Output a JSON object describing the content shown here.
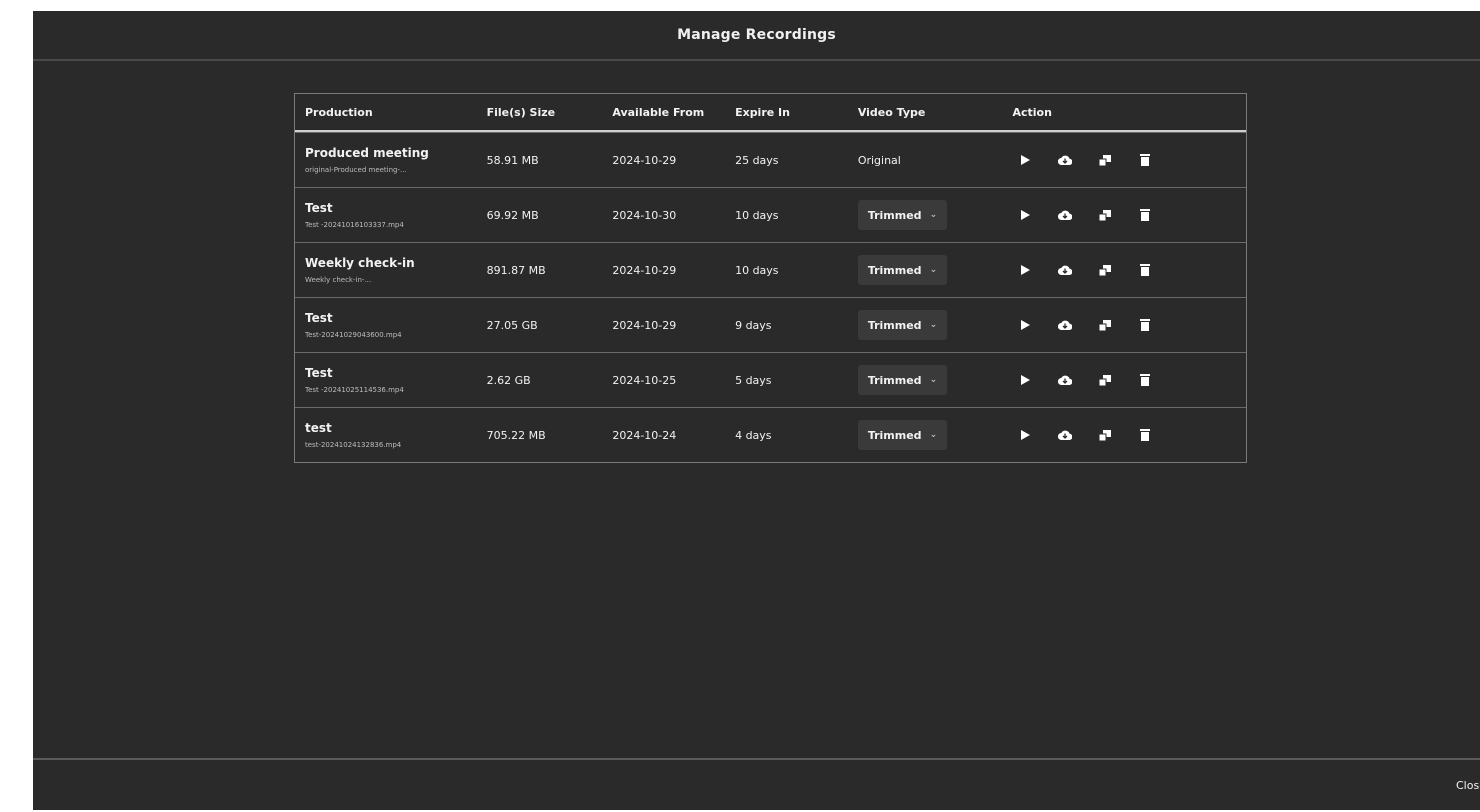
{
  "modal": {
    "title": "Manage Recordings",
    "close_label": "Close"
  },
  "table": {
    "headers": {
      "production": "Production",
      "size": "File(s) Size",
      "available": "Available From",
      "expire": "Expire In",
      "type": "Video Type",
      "action": "Action"
    },
    "rows": [
      {
        "name": "Produced meeting",
        "file": "original-Produced meeting-...",
        "size": "58.91 MB",
        "available": "2024-10-29",
        "expire": "25 days",
        "type": "Original"
      },
      {
        "name": "Test",
        "file": "Test -20241016103337.mp4",
        "size": "69.92 MB",
        "available": "2024-10-30",
        "expire": "10 days",
        "type": "Trimmed"
      },
      {
        "name": "Weekly check-in",
        "file": "Weekly check-in-...",
        "size": "891.87 MB",
        "available": "2024-10-29",
        "expire": "10 days",
        "type": "Trimmed"
      },
      {
        "name": "Test",
        "file": "Test-20241029043600.mp4",
        "size": "27.05 GB",
        "available": "2024-10-29",
        "expire": "9 days",
        "type": "Trimmed"
      },
      {
        "name": "Test",
        "file": "Test -20241025114536.mp4",
        "size": "2.62 GB",
        "available": "2024-10-25",
        "expire": "5 days",
        "type": "Trimmed"
      },
      {
        "name": "test",
        "file": "test-20241024132836.mp4",
        "size": "705.22 MB",
        "available": "2024-10-24",
        "expire": "4 days",
        "type": "Trimmed"
      }
    ]
  },
  "icons": {
    "play": "play-icon",
    "download": "cloud-download-icon",
    "copy": "copy-icon",
    "delete": "trash-icon"
  }
}
